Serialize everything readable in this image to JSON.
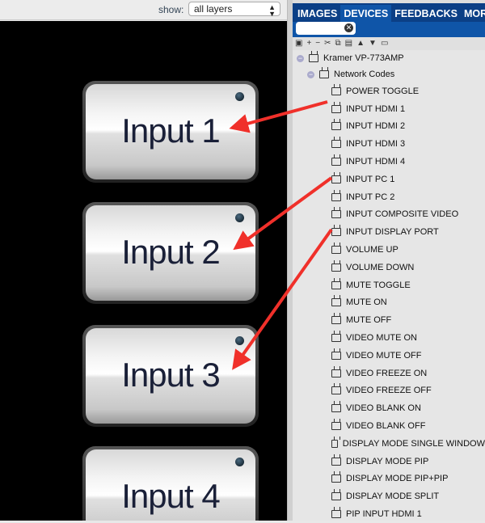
{
  "topbar": {
    "show_label": "show:",
    "layer_select": "all layers"
  },
  "canvas": {
    "buttons": [
      "Input 1",
      "Input 2",
      "Input 3",
      "Input 4"
    ]
  },
  "panel": {
    "tabs": [
      "IMAGES",
      "DEVICES",
      "FEEDBACKS",
      "MORE"
    ],
    "active_tab": "DEVICES",
    "search_value": "",
    "device": "Kramer VP-773AMP",
    "group": "Network Codes",
    "codes": [
      "POWER TOGGLE",
      "INPUT HDMI 1",
      "INPUT HDMI 2",
      "INPUT HDMI 3",
      "INPUT HDMI 4",
      "INPUT PC 1",
      "INPUT PC 2",
      "INPUT COMPOSITE VIDEO",
      "INPUT DISPLAY PORT",
      "VOLUME UP",
      "VOLUME DOWN",
      "MUTE TOGGLE",
      "MUTE ON",
      "MUTE OFF",
      "VIDEO MUTE ON",
      "VIDEO MUTE OFF",
      "VIDEO FREEZE ON",
      "VIDEO FREEZE OFF",
      "VIDEO BLANK ON",
      "VIDEO BLANK OFF",
      "DISPLAY MODE SINGLE WINDOW",
      "DISPLAY MODE PIP",
      "DISPLAY MODE PIP+PIP",
      "DISPLAY MODE SPLIT",
      "PIP INPUT HDMI 1"
    ]
  },
  "annotation_color": "#f0302a"
}
